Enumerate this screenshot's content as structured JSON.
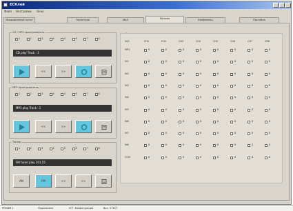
{
  "window": {
    "title": "ЕСКлей"
  },
  "menubar": [
    "Файл",
    "Настройки",
    "Окно"
  ],
  "tabs": [
    {
      "label": "Микрофонный пульт"
    },
    {
      "label": "Гарнитура"
    },
    {
      "label": "Mp3"
    },
    {
      "label": "Музыка",
      "active": true
    },
    {
      "label": "Конференц"
    },
    {
      "label": "Поставка"
    }
  ],
  "groups": [
    {
      "title": "CD / MP3 проигрыватель",
      "channels": [
        "1",
        "2",
        "3",
        "4",
        "5",
        "6",
        "7",
        "8"
      ],
      "display": "CD  play  Track :  1",
      "buttons": [
        {
          "symbol": "play-icon",
          "on": true
        },
        {
          "label": "<<"
        },
        {
          "label": ">>"
        },
        {
          "symbol": "record-icon",
          "on": true
        },
        {
          "symbol": "stop-icon"
        }
      ]
    },
    {
      "title": "MP3 проигрыватель",
      "channels": [
        "1",
        "2",
        "3",
        "4",
        "5",
        "6",
        "7",
        "8"
      ],
      "display": "MP3  play  Track :  1",
      "buttons": [
        {
          "symbol": "play-icon",
          "on": true
        },
        {
          "label": "<<"
        },
        {
          "label": ">>"
        },
        {
          "symbol": "record-icon",
          "on": true
        },
        {
          "symbol": "stop-icon"
        }
      ]
    },
    {
      "title": "Тюнер",
      "channels": [
        "1",
        "2",
        "3",
        "4",
        "5",
        "6",
        "7",
        "8"
      ],
      "display": "FM  tuner  play  101.15",
      "buttons": [
        {
          "label": "AM"
        },
        {
          "label": "FM",
          "on": true
        },
        {
          "label": "<<"
        },
        {
          "label": ">>"
        },
        {
          "symbol": "stop-icon"
        }
      ]
    }
  ],
  "matrix": {
    "title": "Аудио матрица",
    "corner": "IN/C",
    "columns": [
      "CH1",
      "CH2",
      "CH3",
      "CH4",
      "CH5",
      "CH6",
      "CH7",
      "CH8"
    ],
    "rows": [
      "MP3",
      "IN1",
      "IN2",
      "IN3",
      "IN4",
      "IN5",
      "IN6",
      "IN7",
      "IN8",
      "COM"
    ],
    "cell_label": "8"
  },
  "statusbar": [
    "РЕЖИМ 1",
    "Подключено",
    "УСТ. Конфигурация",
    "Вкл. 3 ТЕСТ"
  ],
  "colors": {
    "accent_on": "#63c6dd",
    "display_bg": "#333333"
  }
}
